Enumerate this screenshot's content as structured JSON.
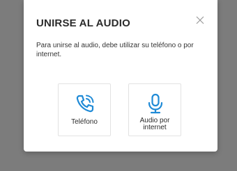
{
  "modal": {
    "title": "UNIRSE AL AUDIO",
    "close_icon": "close-icon",
    "description": "Para unirse al audio, debe utilizar su teléfono o por internet.",
    "options": [
      {
        "label": "Teléfono",
        "icon": "phone-icon"
      },
      {
        "label_line1": "Audio por",
        "label_line2": "internet",
        "icon": "microphone-icon"
      }
    ]
  },
  "colors": {
    "accent": "#1f8ad6",
    "overlay": "#7c7c7c",
    "modal_bg": "#ffffff",
    "title_text": "#2b2b2b"
  }
}
